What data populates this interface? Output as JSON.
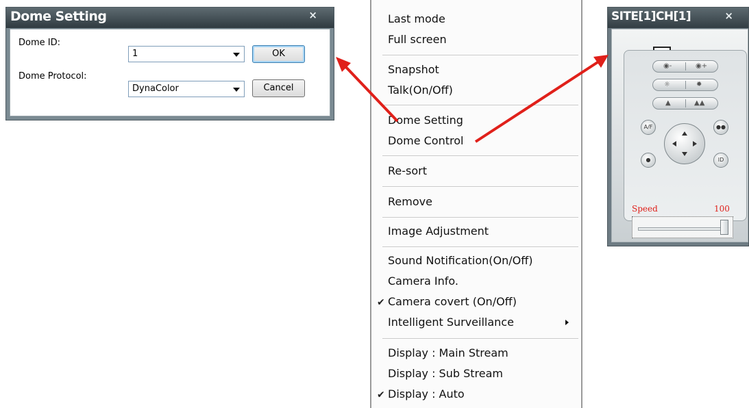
{
  "dome_setting": {
    "title": "Dome Setting",
    "close": "×",
    "dome_id_label": "Dome ID:",
    "dome_id_value": "1",
    "protocol_label": "Dome Protocol:",
    "protocol_value": "DynaColor",
    "ok": "OK",
    "cancel": "Cancel"
  },
  "menu": {
    "items": [
      "Last mode",
      "Full screen",
      "Snapshot",
      "Talk(On/Off)",
      "Dome Setting",
      "Dome Control",
      "Re-sort",
      "Remove",
      "Image Adjustment",
      "Sound Notification(On/Off)",
      "Camera Info.",
      "Camera covert (On/Off)",
      "Intelligent Surveillance",
      "Display : Main Stream",
      "Display : Sub Stream",
      "Display : Auto"
    ],
    "check": "✔"
  },
  "dome_control": {
    "title": "SITE[1]CH[1]",
    "close": "×",
    "speed_label": "Speed",
    "speed_value": "100",
    "speed_level": 1.0,
    "button_labels": {
      "af": "A/F",
      "ms": "●●",
      "rec": "●",
      "id": "ID"
    }
  },
  "colors": {
    "arrow": "#e0201a",
    "speed_text": "#e0201a"
  }
}
